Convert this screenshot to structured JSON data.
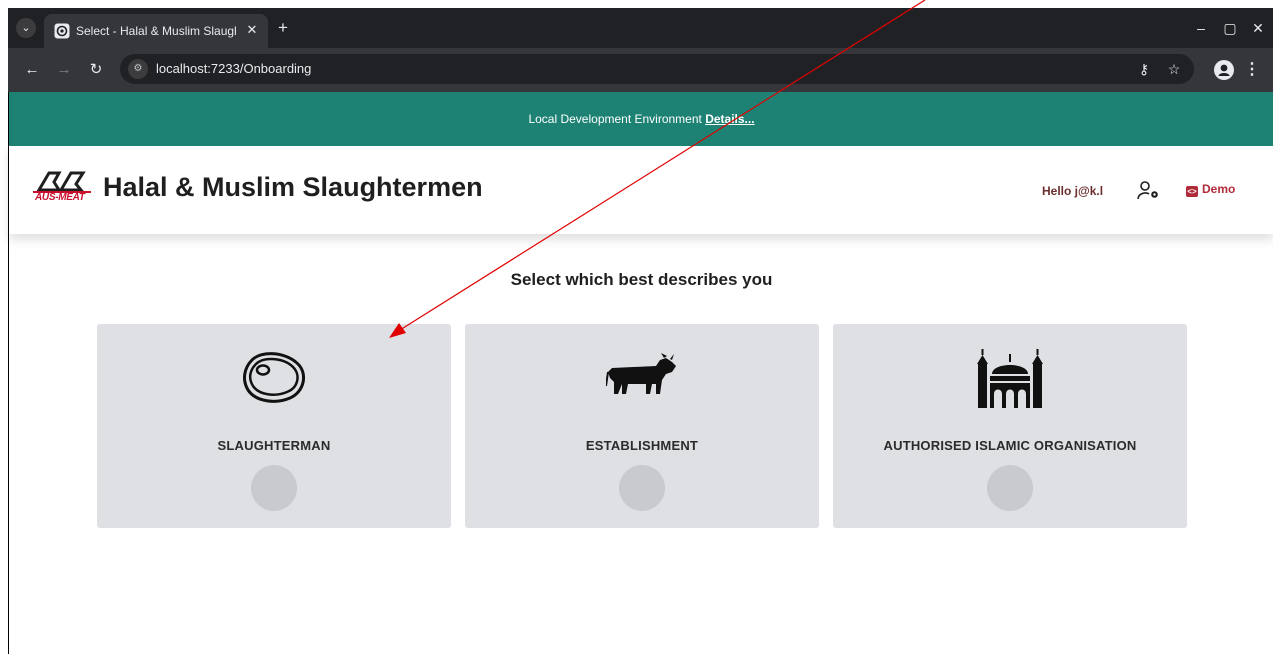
{
  "browser": {
    "tab_title": "Select - Halal & Muslim Slaughtermen",
    "tab_close": "✕",
    "new_tab": "+",
    "url": "localhost:7233/Onboarding",
    "icons": [
      "tab-search-icon",
      "back-icon",
      "forward-icon",
      "reload-icon",
      "site-info-icon",
      "password-key-icon",
      "bookmark-star-icon",
      "profile-icon",
      "menu-icon"
    ],
    "window_buttons": [
      "–",
      "▢",
      "✕"
    ]
  },
  "env_banner": {
    "text": "Local Development Environment ",
    "link": "Details..."
  },
  "header": {
    "logo_text": "AUS-MEAT",
    "title": "Halal & Muslim Slaughtermen",
    "hello": "Hello j@k.l",
    "demo_label": "Demo"
  },
  "main": {
    "prompt": "Select which best describes you",
    "options": [
      {
        "label": "SLAUGHTERMAN",
        "icon": "meat-steak-icon"
      },
      {
        "label": "ESTABLISHMENT",
        "icon": "cow-icon"
      },
      {
        "label": "AUTHORISED ISLAMIC ORGANISATION",
        "icon": "mosque-icon"
      }
    ]
  },
  "colors": {
    "banner": "#1d8274",
    "card": "#dee0e4",
    "radio": "#c8cacd",
    "accent_red": "#b02a37",
    "annotation_arrow": "#e00000"
  }
}
